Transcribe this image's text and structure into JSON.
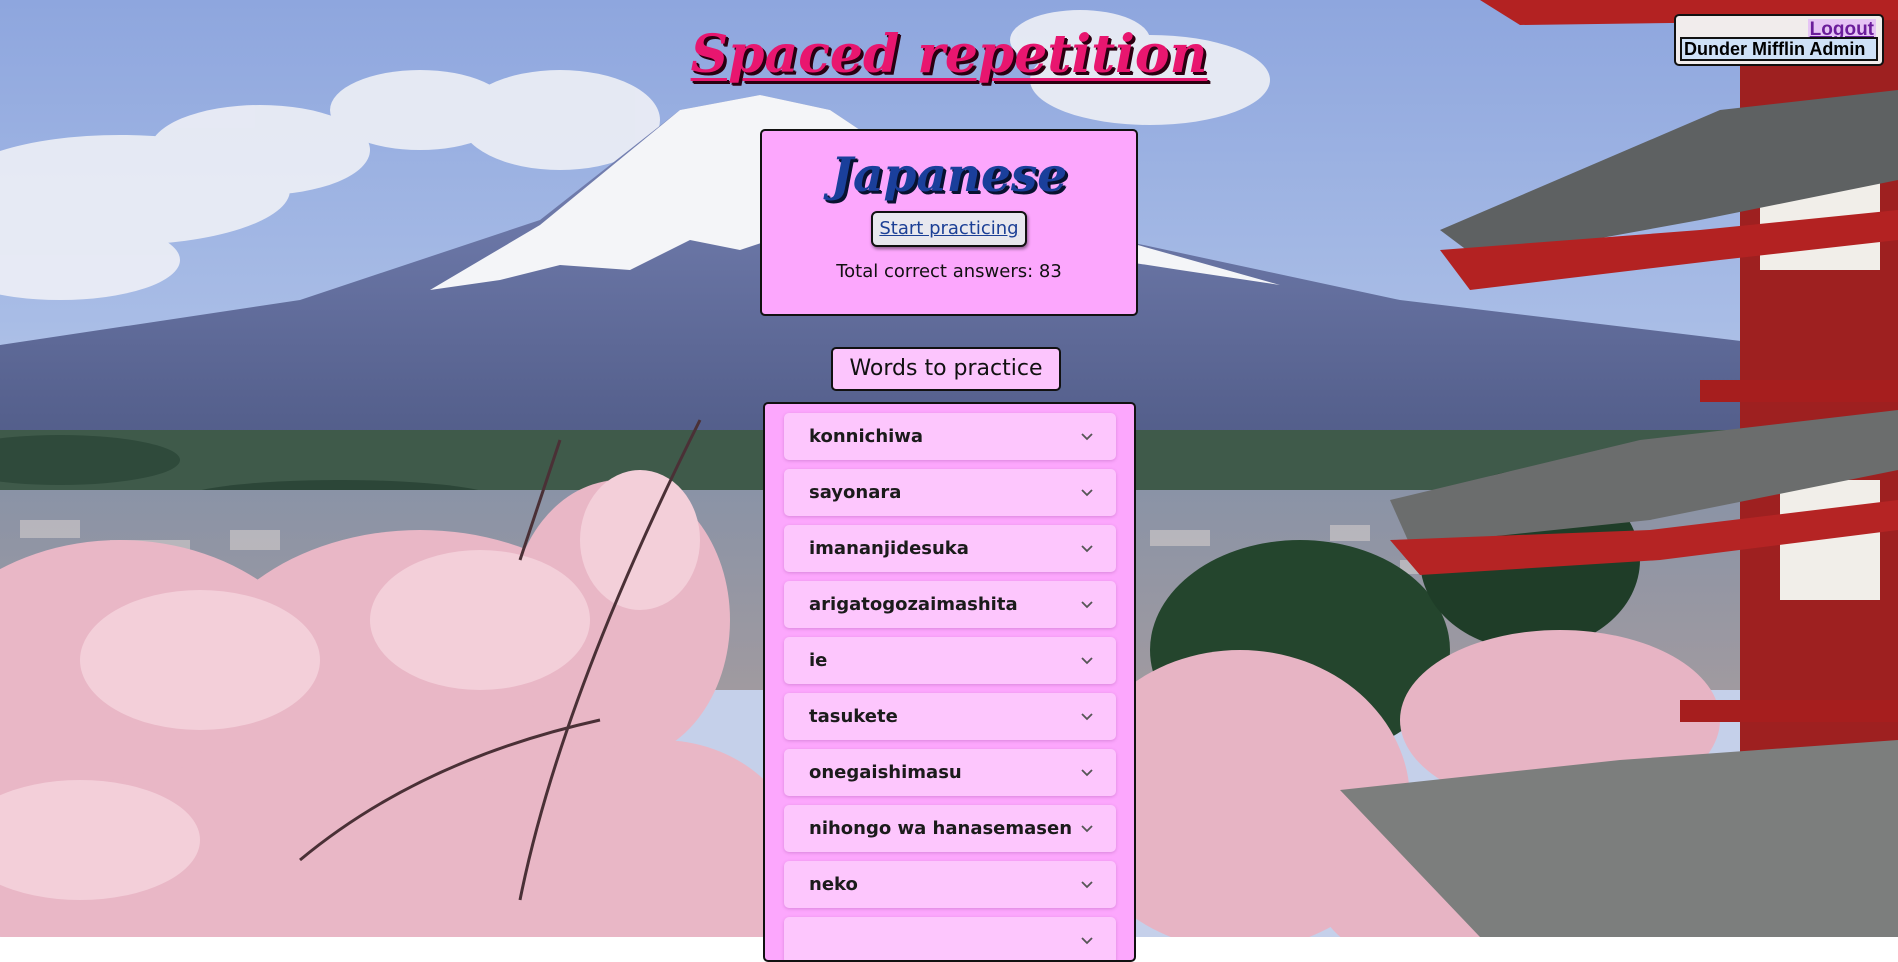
{
  "header": {
    "title": "Spaced repetition"
  },
  "user": {
    "logout_label": "Logout",
    "name": "Dunder Mifflin Admin"
  },
  "language_card": {
    "name": "Japanese",
    "start_label": "Start practicing",
    "total_label": "Total correct answers: 83"
  },
  "words_section": {
    "heading": "Words to practice",
    "items": [
      {
        "word": "konnichiwa",
        "icon": "chevron-down-icon"
      },
      {
        "word": "sayonara",
        "icon": "chevron-down-icon"
      },
      {
        "word": "imananjidesuka",
        "icon": "chevron-down-icon"
      },
      {
        "word": "arigatogozaimashita",
        "icon": "chevron-down-icon"
      },
      {
        "word": "ie",
        "icon": "chevron-down-icon"
      },
      {
        "word": "tasukete",
        "icon": "chevron-down-icon"
      },
      {
        "word": "onegaishimasu",
        "icon": "chevron-down-icon"
      },
      {
        "word": "nihongo wa hanasemasen",
        "icon": "chevron-down-icon"
      },
      {
        "word": "neko",
        "icon": "chevron-down-icon"
      },
      {
        "word": "",
        "icon": "chevron-down-icon"
      }
    ]
  },
  "colors": {
    "title": "#e8166f",
    "language_name": "#1a3f9b",
    "card_background": "#fca7fd",
    "word_item_background": "#fdc6fd",
    "link": "#1b3f95",
    "logout_text": "#6b1d9b"
  }
}
